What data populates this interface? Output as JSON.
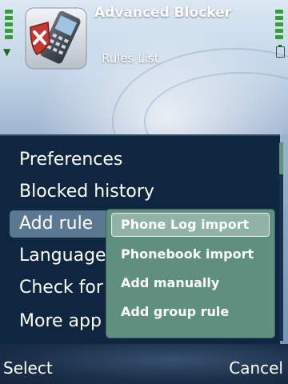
{
  "header": {
    "title": "Advanced Blocker",
    "subtitle": "Rules List",
    "icon": "phone-blocked-icon"
  },
  "status": {
    "signal_icon": "antenna-icon",
    "battery_icon": "battery-icon"
  },
  "menu": {
    "items": [
      {
        "label": "Preferences"
      },
      {
        "label": "Blocked history"
      },
      {
        "label": "Add rule"
      },
      {
        "label": "Language"
      },
      {
        "label": "Check for"
      },
      {
        "label": "More app"
      }
    ],
    "selected_index": 2
  },
  "submenu": {
    "items": [
      {
        "label": "Phone Log import"
      },
      {
        "label": "Phonebook import"
      },
      {
        "label": "Add manually"
      },
      {
        "label": "Add group rule"
      }
    ],
    "selected_index": 0
  },
  "softkeys": {
    "left": "Select",
    "right": "Cancel"
  },
  "colors": {
    "menu_bg": "#0f2640",
    "submenu_bg": "#5e8f7f",
    "selection": "#5b7893",
    "indicator_green": "#33a033"
  }
}
